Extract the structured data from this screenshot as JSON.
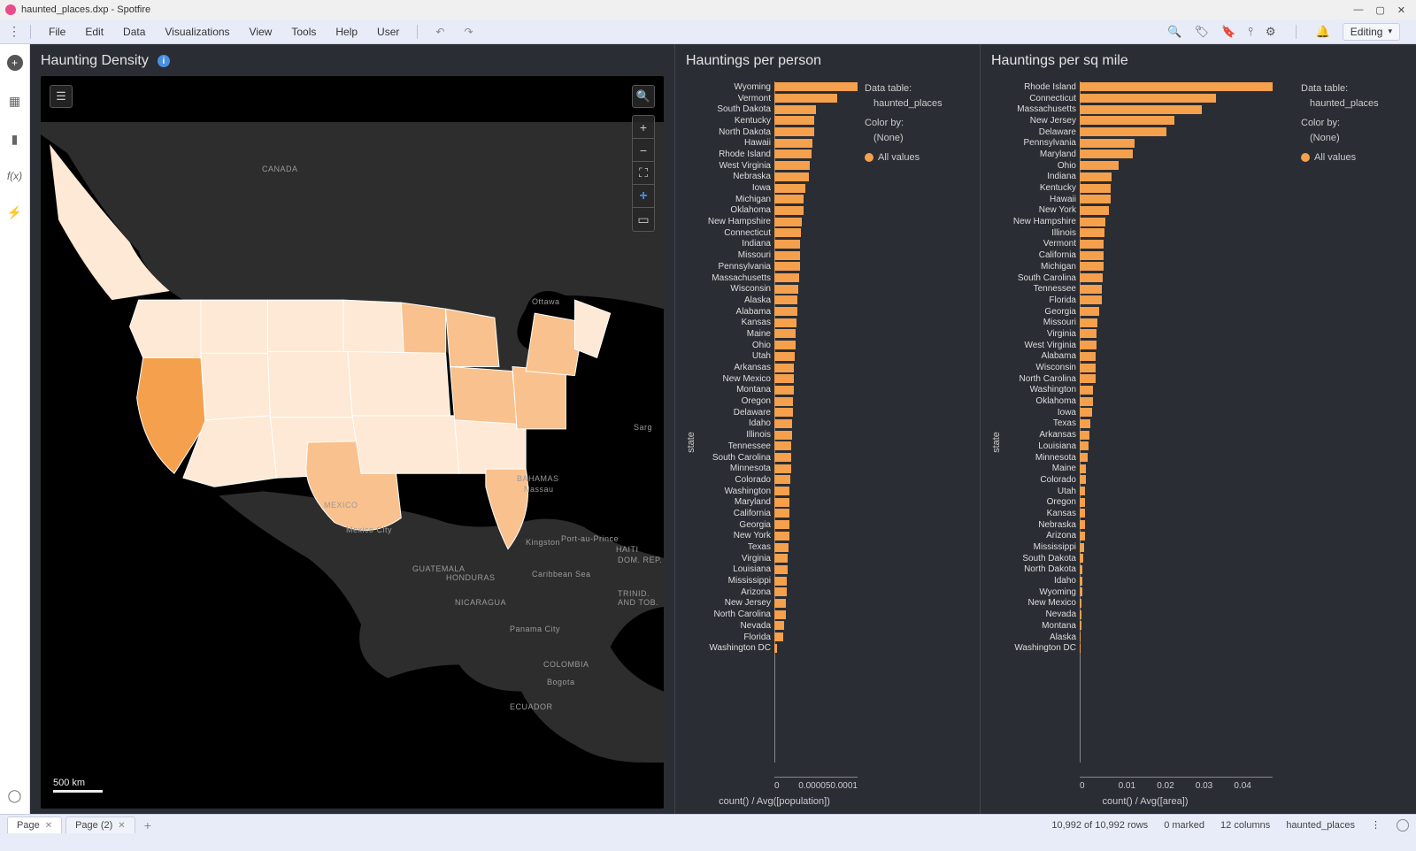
{
  "title": "haunted_places.dxp - Spotfire",
  "window_controls": {
    "min": "—",
    "max": "▢",
    "close": "✕"
  },
  "menu": {
    "items": [
      "File",
      "Edit",
      "Data",
      "Visualizations",
      "View",
      "Tools",
      "Help",
      "User"
    ],
    "undo": "↶",
    "redo": "↷",
    "mode": "Editing"
  },
  "tools": {
    "search": "🔍",
    "tag": "🏷",
    "bookmark": "🔖",
    "filter": "⫯",
    "gear": "⚙",
    "bell": "🔔"
  },
  "lrail": {
    "plus": "+",
    "table": "▦",
    "bar": "▮",
    "fx": "f(x)",
    "bolt": "⚡",
    "rec": "◯"
  },
  "panels": {
    "map": {
      "title": "Haunting Density",
      "scale": "500 km",
      "labels": {
        "canada": "CANADA",
        "mexico": "MEXICO",
        "mexcity": "Mexico City",
        "ottawa": "Ottawa",
        "bahamas": "BAHAMAS",
        "nassau": "Nassau",
        "guat": "GUATEMALA",
        "hond": "HONDURAS",
        "nica": "NICARAGUA",
        "colom": "COLOMBIA",
        "bogota": "Bogota",
        "ecua": "ECUADOR",
        "carib": "Caribbean Sea",
        "kingston": "Kingston",
        "pap": "Port-au-Prince",
        "panama": "Panama City",
        "haiti": "HAITI",
        "dr": "DOM. REP.",
        "trin": "TRINID. AND TOB.",
        "sarg": "Sarg"
      }
    },
    "c1": {
      "title": "Hauntings per person",
      "xlabel": "count() / Avg([population])"
    },
    "c2": {
      "title": "Hauntings per sq mile",
      "xlabel": "count() / Avg([area])"
    }
  },
  "legend": {
    "dt_label": "Data table:",
    "dt_value": "haunted_places",
    "cb_label": "Color by:",
    "cb_value": "(None)",
    "allvals": "All values"
  },
  "status": {
    "page1": "Page",
    "page2": "Page (2)",
    "rows": "10,992 of 10,992 rows",
    "marked": "0 marked",
    "cols": "12 columns",
    "table": "haunted_places"
  },
  "chart_data": [
    {
      "type": "bar",
      "orientation": "horizontal",
      "title": "Hauntings per person",
      "ylabel": "state",
      "xlabel": "count() / Avg([population])",
      "xticks": [
        0,
        5e-05,
        0.0001
      ],
      "series": [
        {
          "name": "All values",
          "color": "#f5a04c"
        }
      ],
      "categories": [
        "Wyoming",
        "Vermont",
        "South Dakota",
        "Kentucky",
        "North Dakota",
        "Hawaii",
        "Rhode Island",
        "West Virginia",
        "Nebraska",
        "Iowa",
        "Michigan",
        "Oklahoma",
        "New Hampshire",
        "Connecticut",
        "Indiana",
        "Missouri",
        "Pennsylvania",
        "Massachusetts",
        "Wisconsin",
        "Alaska",
        "Alabama",
        "Kansas",
        "Maine",
        "Ohio",
        "Utah",
        "Arkansas",
        "New Mexico",
        "Montana",
        "Oregon",
        "Delaware",
        "Idaho",
        "Illinois",
        "Tennessee",
        "South Carolina",
        "Minnesota",
        "Colorado",
        "Washington",
        "Maryland",
        "California",
        "Georgia",
        "New York",
        "Texas",
        "Virginia",
        "Louisiana",
        "Mississippi",
        "Arizona",
        "New Jersey",
        "North Carolina",
        "Nevada",
        "Florida",
        "Washington DC"
      ],
      "values": [
        0.000135,
        0.000102,
        6.7e-05,
        6.5e-05,
        6.4e-05,
        6.2e-05,
        6e-05,
        5.7e-05,
        5.6e-05,
        5e-05,
        4.8e-05,
        4.7e-05,
        4.5e-05,
        4.3e-05,
        4.2e-05,
        4.2e-05,
        4.1e-05,
        4e-05,
        3.9e-05,
        3.8e-05,
        3.7e-05,
        3.6e-05,
        3.5e-05,
        3.5e-05,
        3.3e-05,
        3.2e-05,
        3.1e-05,
        3.1e-05,
        3e-05,
        3e-05,
        2.9e-05,
        2.9e-05,
        2.8e-05,
        2.7e-05,
        2.7e-05,
        2.6e-05,
        2.5e-05,
        2.5e-05,
        2.5e-05,
        2.4e-05,
        2.4e-05,
        2.3e-05,
        2.2e-05,
        2.1e-05,
        2e-05,
        2e-05,
        1.9e-05,
        1.8e-05,
        1.6e-05,
        1.4e-05,
        5e-06
      ]
    },
    {
      "type": "bar",
      "orientation": "horizontal",
      "title": "Hauntings per sq mile",
      "ylabel": "state",
      "xlabel": "count() / Avg([area])",
      "xticks": [
        0,
        0.01,
        0.02,
        0.03,
        0.04
      ],
      "series": [
        {
          "name": "All values",
          "color": "#f5a04c"
        }
      ],
      "categories": [
        "Rhode Island",
        "Connecticut",
        "Massachusetts",
        "New Jersey",
        "Delaware",
        "Pennsylvania",
        "Maryland",
        "Ohio",
        "Indiana",
        "Kentucky",
        "Hawaii",
        "New York",
        "New Hampshire",
        "Illinois",
        "Vermont",
        "California",
        "Michigan",
        "South Carolina",
        "Tennessee",
        "Florida",
        "Georgia",
        "Missouri",
        "Virginia",
        "West Virginia",
        "Alabama",
        "Wisconsin",
        "North Carolina",
        "Washington",
        "Oklahoma",
        "Iowa",
        "Texas",
        "Arkansas",
        "Louisiana",
        "Minnesota",
        "Maine",
        "Colorado",
        "Utah",
        "Oregon",
        "Kansas",
        "Nebraska",
        "Arizona",
        "Mississippi",
        "South Dakota",
        "North Dakota",
        "Idaho",
        "Wyoming",
        "New Mexico",
        "Nevada",
        "Montana",
        "Alaska",
        "Washington DC"
      ],
      "values": [
        0.0408,
        0.0289,
        0.0258,
        0.02,
        0.0183,
        0.0116,
        0.0112,
        0.0083,
        0.0067,
        0.0066,
        0.0065,
        0.0062,
        0.0054,
        0.0052,
        0.0051,
        0.005,
        0.005,
        0.0048,
        0.0047,
        0.0046,
        0.0042,
        0.0038,
        0.0036,
        0.0035,
        0.0034,
        0.0034,
        0.0033,
        0.0029,
        0.0028,
        0.0027,
        0.0022,
        0.002,
        0.0019,
        0.0016,
        0.0014,
        0.0013,
        0.0012,
        0.0012,
        0.0012,
        0.0011,
        0.0011,
        0.001,
        0.0007,
        0.0006,
        0.0005,
        0.0005,
        0.0004,
        0.0004,
        0.0003,
        0.0001,
        0.0001
      ]
    }
  ]
}
